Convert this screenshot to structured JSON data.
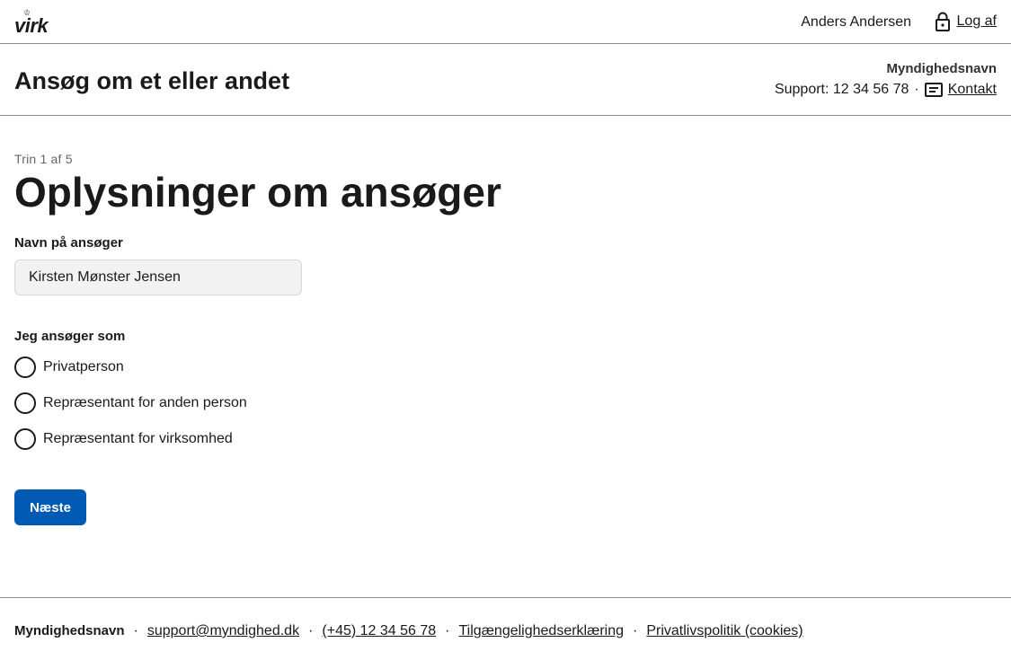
{
  "topbar": {
    "logo_text": "virk",
    "user_name": "Anders Andersen",
    "logout_label": "Log af"
  },
  "header": {
    "title": "Ansøg om et eller andet",
    "authority": "Myndighedsnavn",
    "support_label": "Support: 12 34 56 78",
    "separator": "·",
    "contact_label": "Kontakt"
  },
  "form": {
    "step": "Trin 1 af 5",
    "title": "Oplysninger om ansøger",
    "name_label": "Navn på ansøger",
    "name_value": "Kirsten Mønster Jensen",
    "role_label": "Jeg ansøger som",
    "options": [
      {
        "label": "Privatperson",
        "selected": false
      },
      {
        "label": "Repræsentant for anden person",
        "selected": false
      },
      {
        "label": "Repræsentant for virksomhed",
        "selected": false
      }
    ],
    "next_label": "Næste"
  },
  "footer": {
    "authority": "Myndighedsnavn",
    "separator": "·",
    "email": "support@myndighed.dk",
    "phone": "(+45) 12 34 56 78",
    "accessibility": "Tilgængelighedserklæring",
    "privacy": "Privatlivspolitik (cookies)"
  },
  "colors": {
    "primary": "#0059b3",
    "text": "#1a1a1a",
    "divider": "#8c8c8c",
    "input_bg": "#f2f2f2"
  }
}
